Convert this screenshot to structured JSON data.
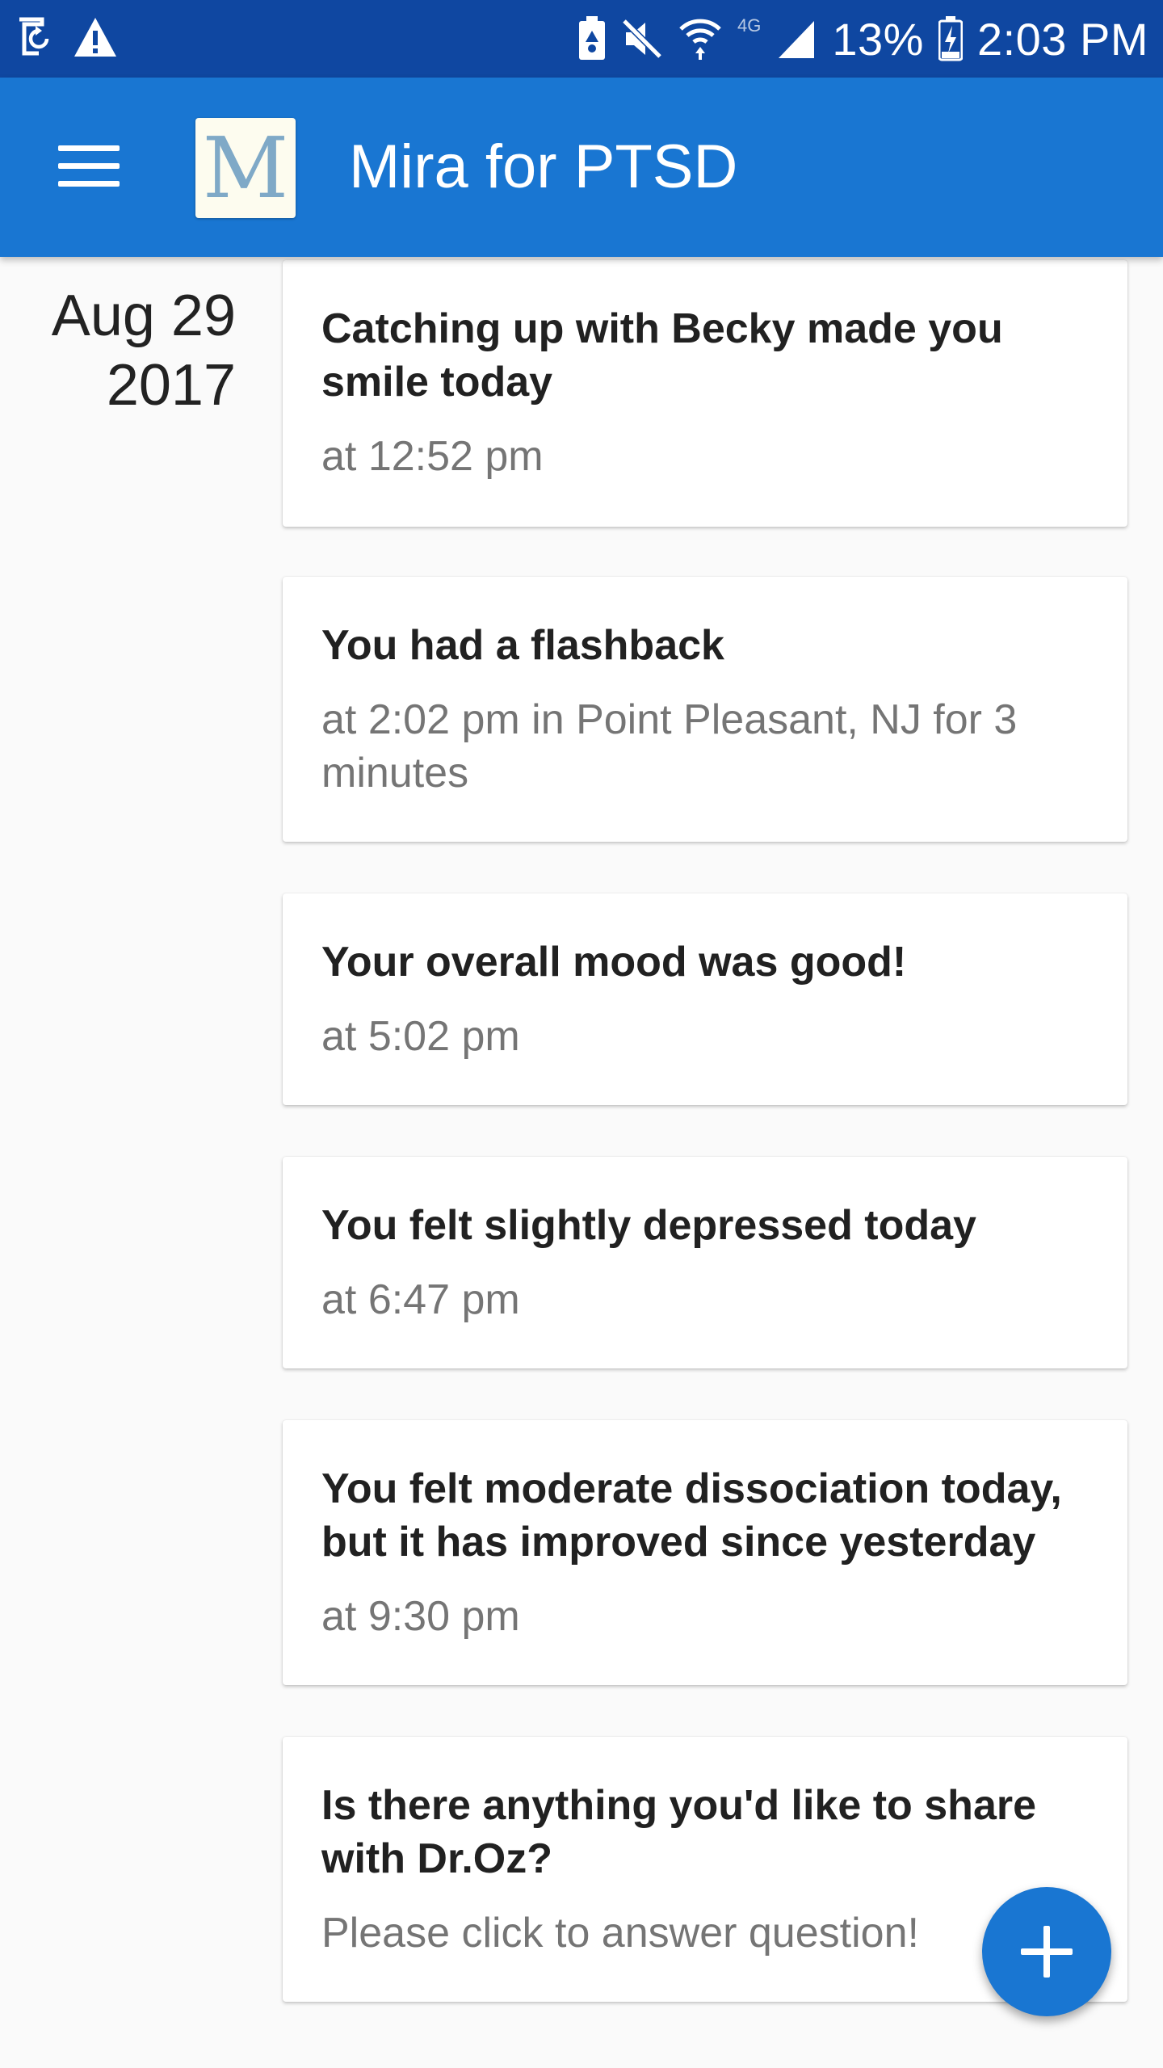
{
  "status_bar": {
    "battery": "13%",
    "time": "2:03 PM",
    "network": "4G"
  },
  "app_bar": {
    "title": "Mira for PTSD",
    "logo_letter": "M"
  },
  "timeline": {
    "date_line1": "Aug 29",
    "date_line2": "2017",
    "cards": [
      {
        "title": "Catching up with Becky made you smile today",
        "subtitle": "at 12:52 pm"
      },
      {
        "title": "You had a flashback",
        "subtitle": "at 2:02 pm in Point Pleasant, NJ for 3 minutes"
      },
      {
        "title": "Your overall mood was good!",
        "subtitle": "at 5:02 pm"
      },
      {
        "title": "You felt slightly depressed today",
        "subtitle": "at 6:47 pm"
      },
      {
        "title": "You felt moderate dissociation today, but it has improved since yesterday",
        "subtitle": "at 9:30 pm"
      },
      {
        "title": "Is there anything you'd like to share with Dr.Oz?",
        "subtitle": "Please click to answer question!"
      }
    ]
  },
  "colors": {
    "status_bar": "#0f47a1",
    "app_bar": "#1976d2",
    "fab": "#1976d2",
    "background": "#fafafa"
  },
  "icons": {
    "menu": "hamburger-menu-icon",
    "fab": "plus-icon"
  }
}
